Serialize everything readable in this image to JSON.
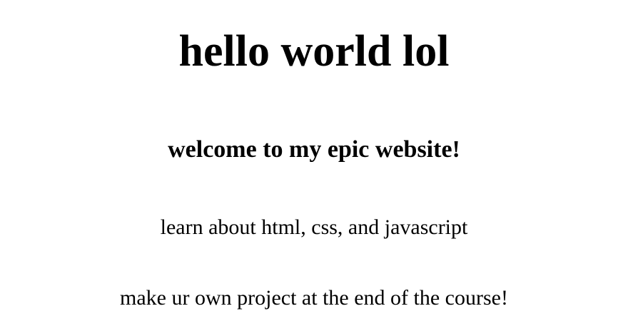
{
  "page": {
    "heading": "hello world lol",
    "subheading": "welcome to my epic website!",
    "paragraphs": [
      "learn about html, css, and javascript",
      "make ur own project at the end of the course!"
    ]
  },
  "colors": {
    "background": "#ffffff",
    "text": "#000000"
  }
}
